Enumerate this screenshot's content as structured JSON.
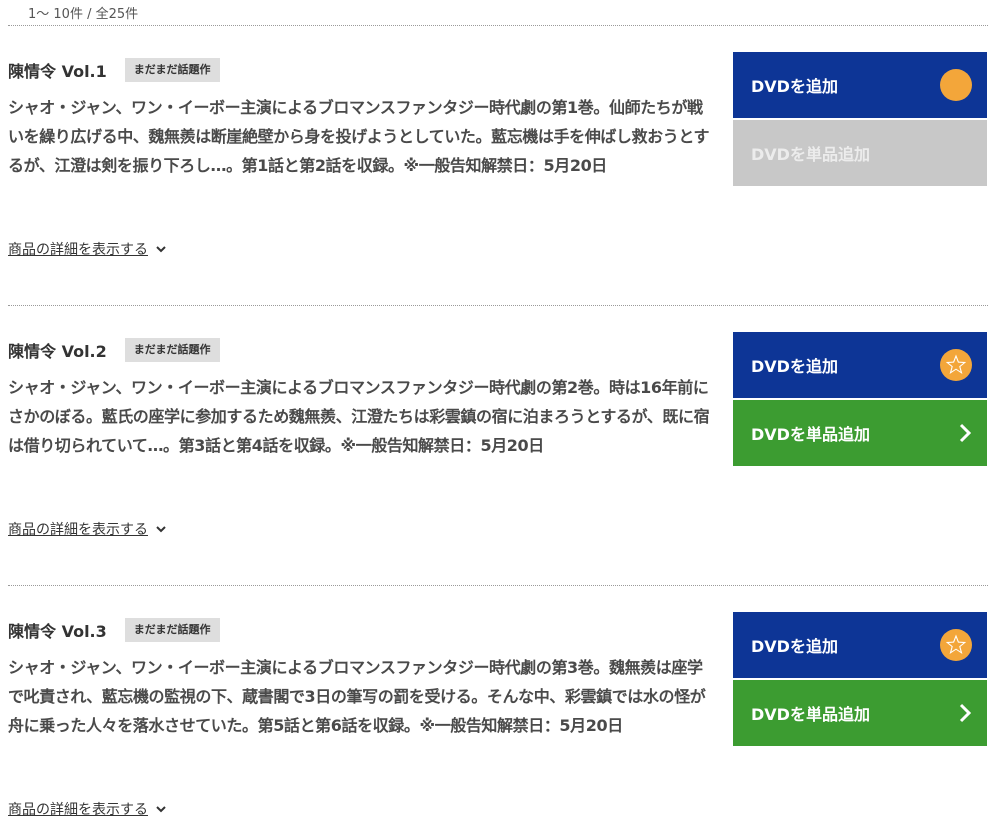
{
  "result_count": "1〜 10件 / 全25件",
  "colors": {
    "add_button": "#0d3596",
    "single_button_active": "#3c9c31",
    "single_button_disabled": "#c8c8c8",
    "badge_bg": "#dedede",
    "icon_orange": "#f3a63a"
  },
  "items": [
    {
      "title": "陳情令 Vol.1",
      "badge": "まだまだ話題作",
      "description": "シャオ・ジャン、ワン・イーボー主演によるブロマンスファンタジー時代劇の第1巻。仙師たちが戦いを繰り広げる中、魏無羨は断崖絶壁から身を投げようとしていた。藍忘機は手を伸ばし救おうとするが、江澄は剣を振り下ろし…。第1話と第2話を収録。※一般告知解禁日：5月20日",
      "details_link": "商品の詳細を表示する",
      "add_button": "DVDを追加",
      "add_icon": "orange-circle-icon",
      "single_button": "DVDを単品追加",
      "single_state": "disabled"
    },
    {
      "title": "陳情令 Vol.2",
      "badge": "まだまだ話題作",
      "description": "シャオ・ジャン、ワン・イーボー主演によるブロマンスファンタジー時代劇の第2巻。時は16年前にさかのぼる。藍氏の座学に参加するため魏無羨、江澄たちは彩雲鎮の宿に泊まろうとするが、既に宿は借り切られていて…。第3話と第4話を収録。※一般告知解禁日：5月20日",
      "details_link": "商品の詳細を表示する",
      "add_button": "DVDを追加",
      "add_icon": "star-icon",
      "single_button": "DVDを単品追加",
      "single_state": "active"
    },
    {
      "title": "陳情令 Vol.3",
      "badge": "まだまだ話題作",
      "description": "シャオ・ジャン、ワン・イーボー主演によるブロマンスファンタジー時代劇の第3巻。魏無羨は座学で叱責され、藍忘機の監視の下、蔵書閣で3日の筆写の罰を受ける。そんな中、彩雲鎮では水の怪が舟に乗った人々を落水させていた。第5話と第6話を収録。※一般告知解禁日：5月20日",
      "details_link": "商品の詳細を表示する",
      "add_button": "DVDを追加",
      "add_icon": "star-icon",
      "single_button": "DVDを単品追加",
      "single_state": "active"
    }
  ]
}
